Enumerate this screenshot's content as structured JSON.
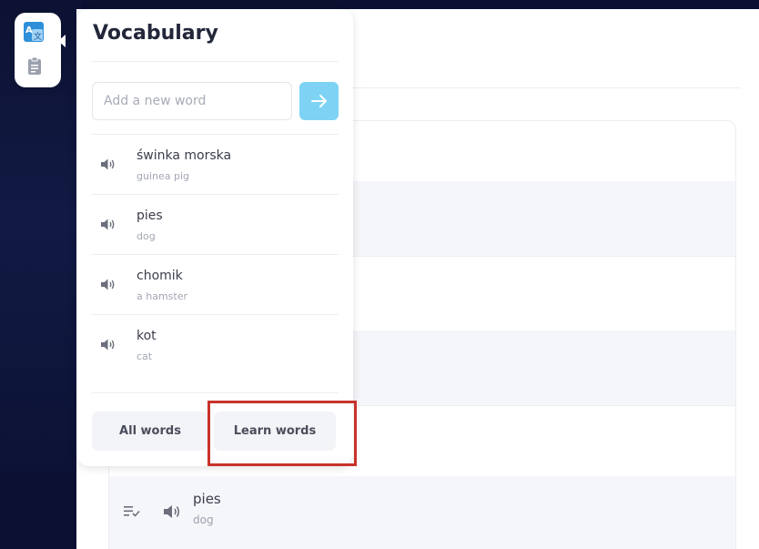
{
  "popup": {
    "title": "Vocabulary",
    "input_placeholder": "Add a new word",
    "submit_icon": "arrow-right-icon",
    "words": [
      {
        "word": "świnka morska",
        "translation": "guinea pig"
      },
      {
        "word": "pies",
        "translation": "dog"
      },
      {
        "word": "chomik",
        "translation": "a hamster"
      },
      {
        "word": "kot",
        "translation": "cat"
      }
    ],
    "tabs": {
      "all_label": "All words",
      "learn_label": "Learn words"
    }
  },
  "rail": {
    "icons": [
      "translate-icon",
      "clipboard-icon"
    ]
  },
  "background_list": {
    "visible_word": "pies",
    "visible_translation": "dog"
  },
  "colors": {
    "accent": "#7ed3f5",
    "highlight": "#c8332a",
    "title": "#23273a"
  }
}
